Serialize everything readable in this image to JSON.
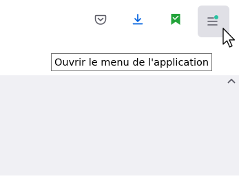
{
  "toolbar": {
    "buttons": [
      {
        "icon": "pocket-icon"
      },
      {
        "icon": "download-icon",
        "color": "#0061e0"
      },
      {
        "icon": "extension-bookmark-icon",
        "color": "#22a33a"
      },
      {
        "icon": "app-menu-icon",
        "badge_color": "#2ac3a2"
      }
    ]
  },
  "tooltip": {
    "text": "Ouvrir le menu de l'application"
  },
  "colors": {
    "content_bg": "#f0f0f4",
    "hover_bg": "#e0e0e6",
    "tooltip_border": "#767676"
  }
}
